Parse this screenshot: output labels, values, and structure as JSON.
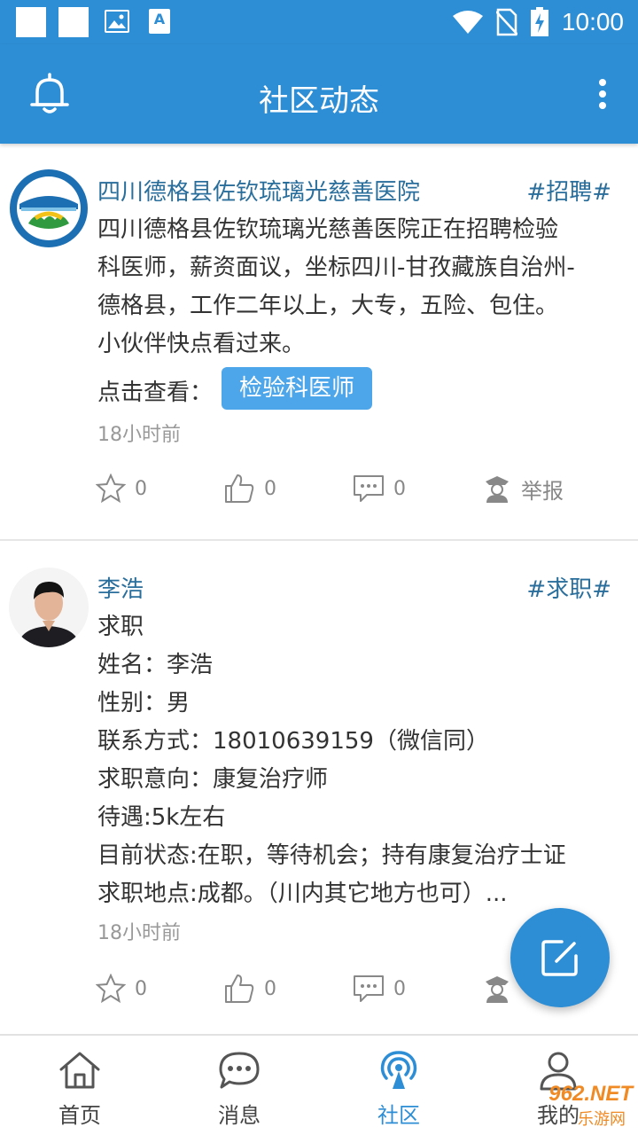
{
  "status_bar": {
    "time": "10:00"
  },
  "app_bar": {
    "title": "社区动态",
    "left_icon": "bell-icon",
    "right_icon": "more-vertical-icon"
  },
  "posts": [
    {
      "author": "四川德格县佐钦琉璃光慈善医院",
      "tag": "#招聘#",
      "body_lines": [
        "四川德格县佐钦琉璃光慈善医院正在招聘检验",
        "科医师，薪资面议，坐标四川-甘孜藏族自治州-",
        "德格县，工作二年以上，大专，五险、包住。",
        "小伙伴快点看过来。"
      ],
      "view_label": "点击查看：",
      "view_chip": "检验科医师",
      "time": "18小时前",
      "actions": {
        "favorite_count": "0",
        "like_count": "0",
        "comment_count": "0",
        "report_label": "举报"
      }
    },
    {
      "author": "李浩",
      "tag": "#求职#",
      "body_lines": [
        "求职",
        "姓名：李浩",
        "性别：男",
        "联系方式：18010639159（微信同）",
        "求职意向：康复治疗师",
        "待遇:5k左右",
        "目前状态:在职，等待机会；持有康复治疗士证",
        "求职地点:成都。（川内其它地方也可）..."
      ],
      "time": "18小时前",
      "actions": {
        "favorite_count": "0",
        "like_count": "0",
        "comment_count": "0"
      }
    }
  ],
  "fab": {
    "icon": "edit-icon"
  },
  "bottom_nav": {
    "items": [
      {
        "label": "首页",
        "icon": "home-icon"
      },
      {
        "label": "消息",
        "icon": "message-icon"
      },
      {
        "label": "社区",
        "icon": "broadcast-icon",
        "active": true
      },
      {
        "label": "我的",
        "icon": "user-icon"
      }
    ]
  },
  "watermark": {
    "text": "962.NET",
    "sub": "乐游网"
  },
  "colors": {
    "primary": "#2d8ed6",
    "chip": "#4ea6ea",
    "author": "#2a6e9c",
    "muted": "#999999"
  }
}
